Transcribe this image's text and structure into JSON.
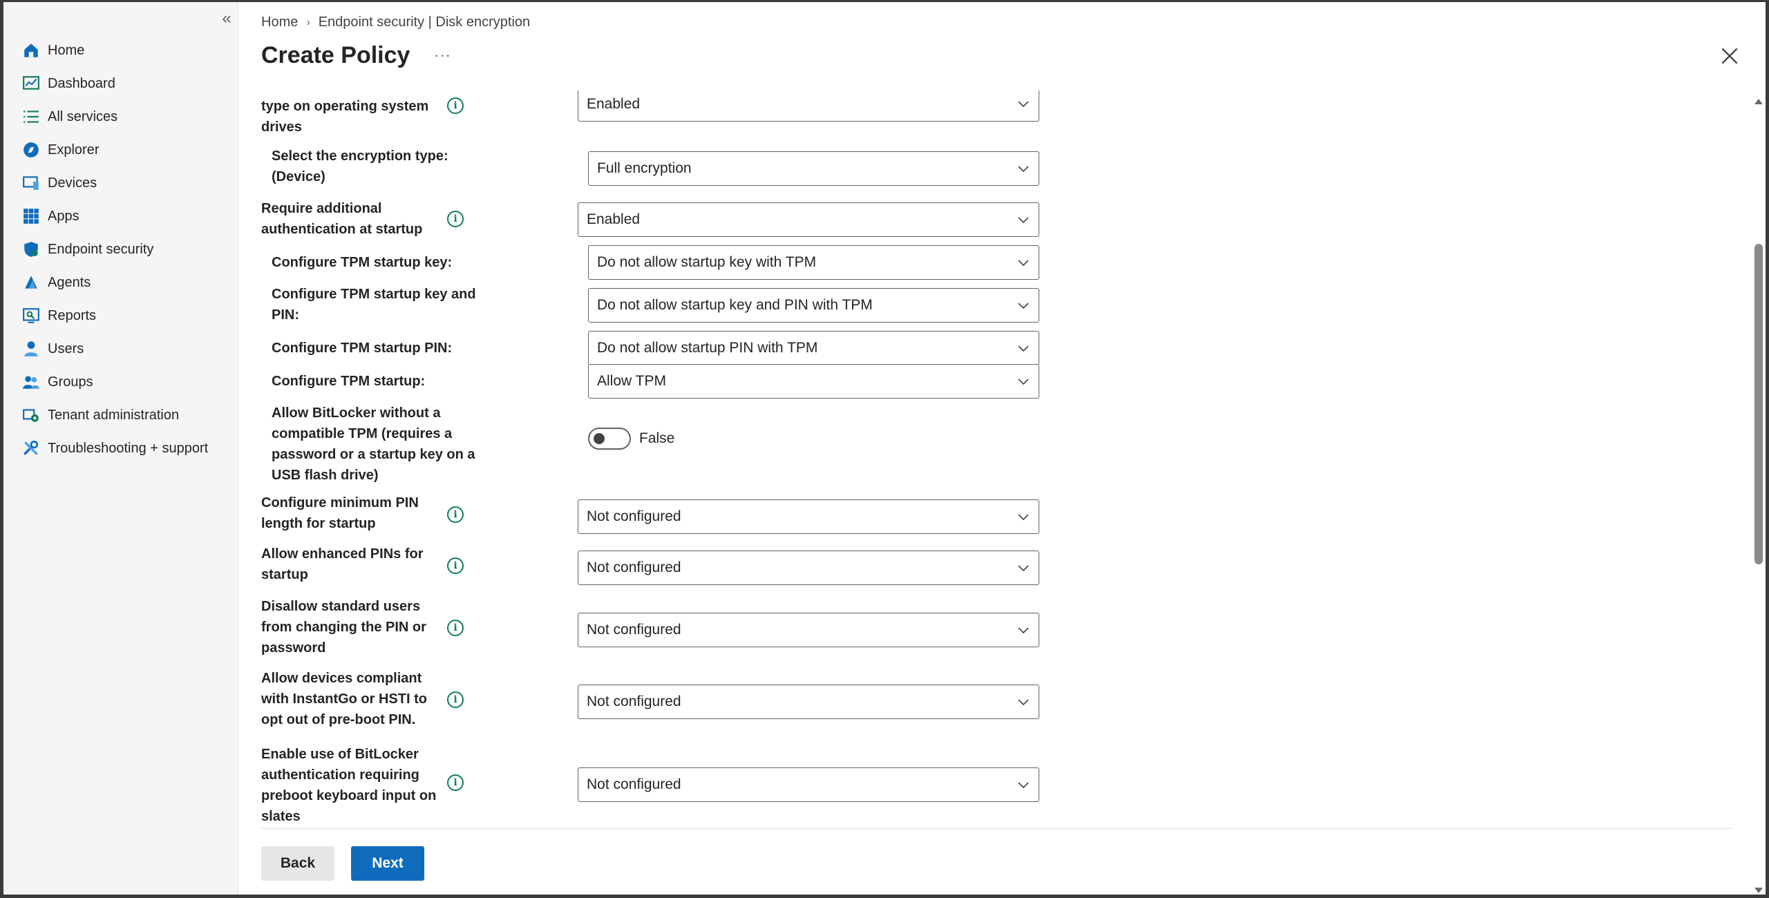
{
  "sidebar": {
    "collapse_icon": "«",
    "items": [
      {
        "label": "Home",
        "icon": "home-icon"
      },
      {
        "label": "Dashboard",
        "icon": "dashboard-icon"
      },
      {
        "label": "All services",
        "icon": "list-icon"
      },
      {
        "label": "Explorer",
        "icon": "explorer-icon"
      },
      {
        "label": "Devices",
        "icon": "devices-icon"
      },
      {
        "label": "Apps",
        "icon": "apps-icon"
      },
      {
        "label": "Endpoint security",
        "icon": "shield-icon"
      },
      {
        "label": "Agents",
        "icon": "agents-icon"
      },
      {
        "label": "Reports",
        "icon": "reports-icon"
      },
      {
        "label": "Users",
        "icon": "user-icon"
      },
      {
        "label": "Groups",
        "icon": "groups-icon"
      },
      {
        "label": "Tenant administration",
        "icon": "tenant-icon"
      },
      {
        "label": "Troubleshooting + support",
        "icon": "wrench-icon"
      }
    ]
  },
  "header": {
    "breadcrumb": [
      "Home",
      "Endpoint security | Disk encryption"
    ],
    "title": "Create Policy",
    "more": "···"
  },
  "settings": [
    {
      "label": "type on operating system drives",
      "value": "Enabled"
    },
    {
      "label": "Select the encryption type: (Device)",
      "value": "Full encryption"
    },
    {
      "label": "Require additional authentication at startup",
      "value": "Enabled"
    },
    {
      "label": "Configure TPM startup key:",
      "value": "Do not allow startup key with TPM"
    },
    {
      "label": "Configure TPM startup key and PIN:",
      "value": "Do not allow startup key and PIN with TPM"
    },
    {
      "label": "Configure TPM startup PIN:",
      "value": "Do not allow startup PIN with TPM"
    },
    {
      "label": "Configure TPM startup:",
      "value": "Allow TPM"
    },
    {
      "label": "Allow BitLocker without a compatible TPM (requires a password or a startup key on a USB flash drive)",
      "value": "False"
    },
    {
      "label": "Configure minimum PIN length for startup",
      "value": "Not configured"
    },
    {
      "label": "Allow enhanced PINs for startup",
      "value": "Not configured"
    },
    {
      "label": "Disallow standard users from changing the PIN or password",
      "value": "Not configured"
    },
    {
      "label": "Allow devices compliant with InstantGo or HSTI to opt out of pre-boot PIN.",
      "value": "Not configured"
    },
    {
      "label": "Enable use of BitLocker authentication requiring preboot keyboard input on slates",
      "value": "Not configured"
    }
  ],
  "info_icon": "i",
  "footer": {
    "back": "Back",
    "next": "Next"
  },
  "colors": {
    "accent": "#0f6cbd",
    "info": "#0f7b5f"
  }
}
